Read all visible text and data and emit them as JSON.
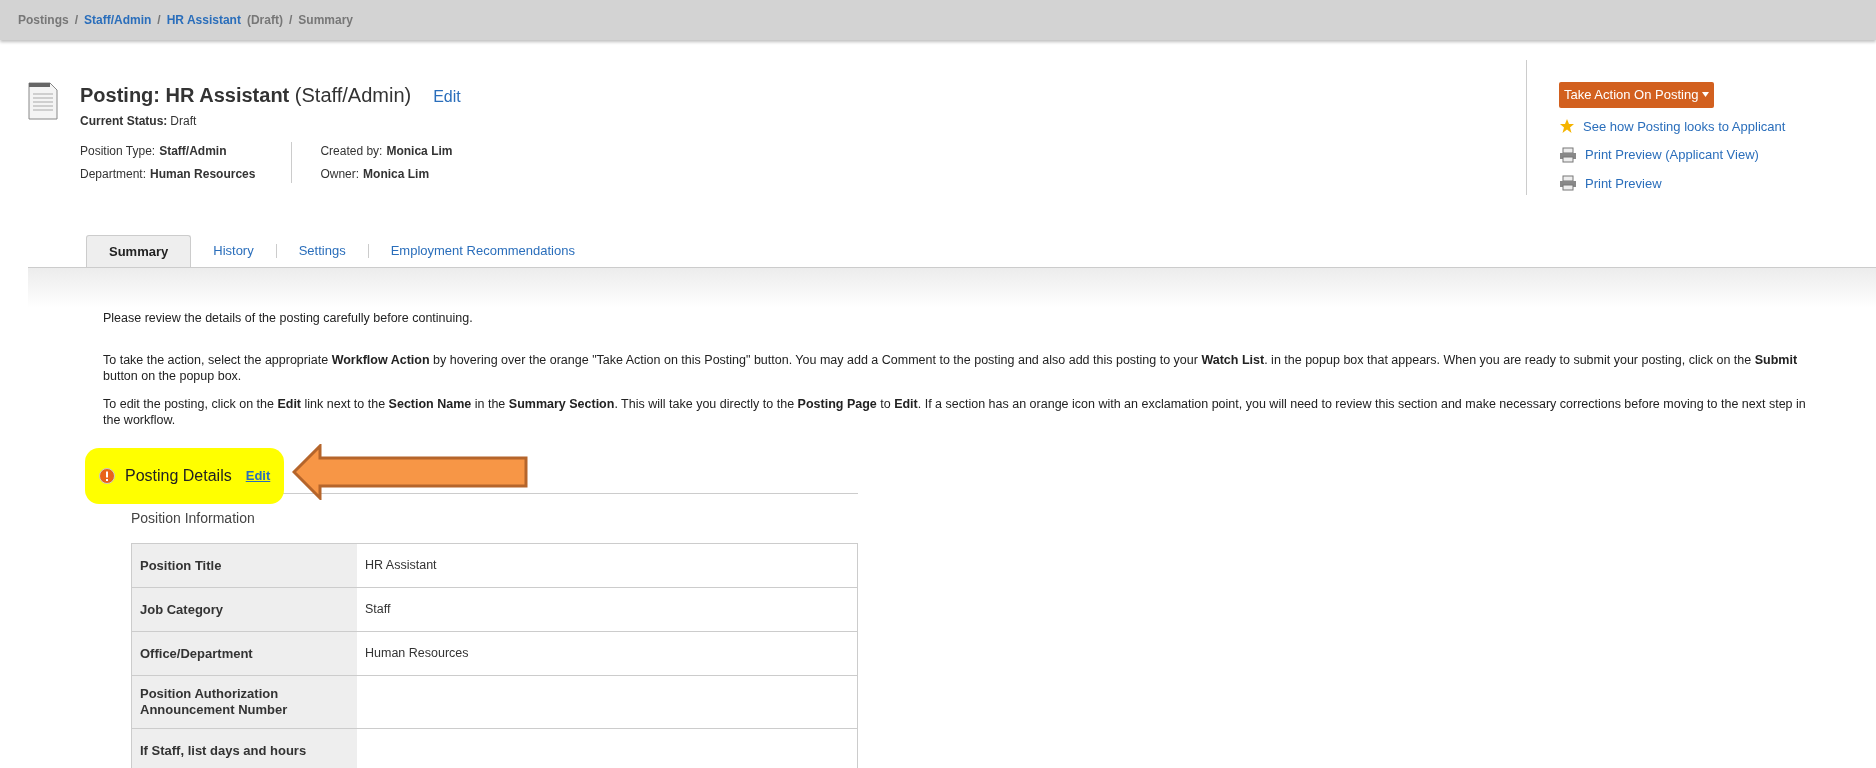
{
  "breadcrumb_separator": "/",
  "breadcrumbs": [
    {
      "label": "Postings",
      "kind": "text"
    },
    {
      "label": "Staff/Admin",
      "kind": "link"
    },
    {
      "label": "HR Assistant",
      "kind": "link",
      "suffix": "(Draft)"
    },
    {
      "label": "Summary",
      "kind": "text"
    }
  ],
  "header": {
    "title_bold": "Posting: HR Assistant",
    "title_rest": "(Staff/Admin)",
    "edit": "Edit",
    "status_label": "Current Status:",
    "status": "Draft",
    "meta_left": [
      {
        "label": "Position Type:",
        "value": "Staff/Admin"
      },
      {
        "label": "Department:",
        "value": "Human Resources"
      }
    ],
    "meta_right": [
      {
        "label": "Created by:",
        "value": "Monica Lim"
      },
      {
        "label": "Owner:",
        "value": "Monica Lim"
      }
    ]
  },
  "actions": {
    "button": "Take Action On Posting",
    "links": [
      {
        "label": "See how Posting looks to Applicant",
        "kind": "star"
      },
      {
        "label": "Print Preview (Applicant View)",
        "kind": "printer"
      },
      {
        "label": "Print Preview",
        "kind": "printer"
      }
    ]
  },
  "tabs": [
    {
      "label": "Summary",
      "selected": true
    },
    {
      "label": "History",
      "selected": false
    },
    {
      "label": "Settings",
      "selected": false
    },
    {
      "label": "Employment Recommendations",
      "selected": false
    }
  ],
  "paragraphs": [
    "Please review the details of the posting carefully before continuing.",
    "To take the action, select the appropriate **Workflow Action** by hovering over the orange \"Take Action on this Posting\" button. You may add a Comment to the posting and also add this posting to your **Watch List**. in the popup box that appears. When you are ready to submit your posting, click on the **Submit** button on the popup box.",
    "To edit the posting, click on the **Edit** link next to the **Section Name** in the **Summary Section**. This will take you directly to the **Posting Page** to **Edit**. If a section has an orange icon with an exclamation point, you will need to review this section and make necessary corrections before moving to the next step in the workflow."
  ],
  "section": {
    "title": "Posting Details",
    "edit": "Edit",
    "subtitle": "Position Information",
    "rows": [
      {
        "label": "Position Title",
        "value": "HR Assistant"
      },
      {
        "label": "Job Category",
        "value": "Staff"
      },
      {
        "label": "Office/Department",
        "value": "Human Resources"
      },
      {
        "label": "Position Authorization Announcement Number"
      },
      {
        "label": "If Staff, list days and hours"
      }
    ]
  }
}
